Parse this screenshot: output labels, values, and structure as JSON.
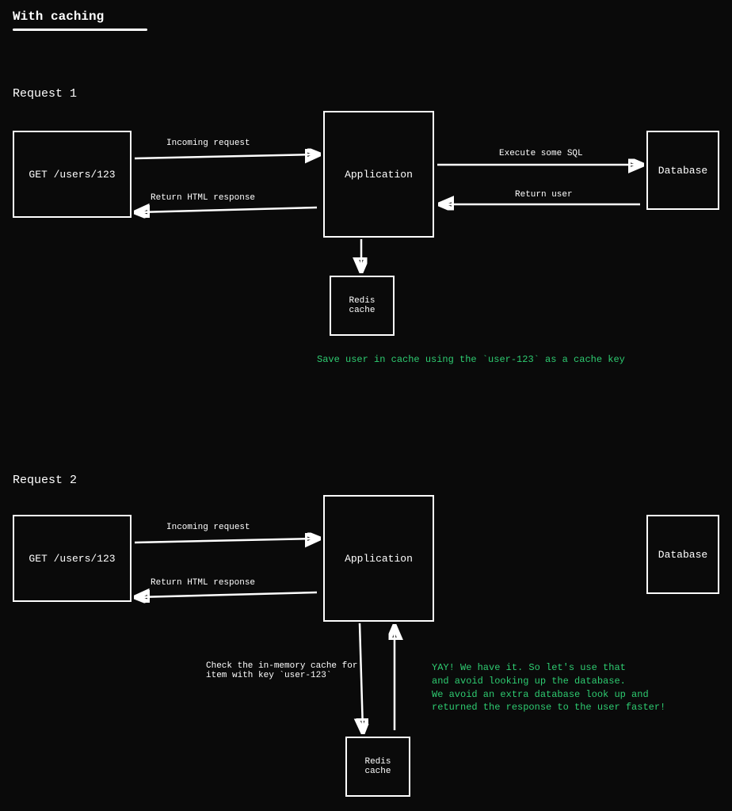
{
  "title": "With caching",
  "sections": {
    "req1": {
      "heading": "Request 1"
    },
    "req2": {
      "heading": "Request 2"
    }
  },
  "boxes": {
    "client1": "GET /users/123",
    "app1": "Application",
    "db1": "Database",
    "redis1": "Redis cache",
    "client2": "GET /users/123",
    "app2": "Application",
    "db2": "Database",
    "redis2": "Redis cache"
  },
  "labels": {
    "incoming1": "Incoming request",
    "returnHtml1": "Return HTML response",
    "execSql": "Execute some SQL",
    "returnUser": "Return user",
    "incoming2": "Incoming request",
    "returnHtml2": "Return HTML response",
    "checkCache": "Check the in-memory cache for\nitem with key `user-123`"
  },
  "notes": {
    "saveCache": "Save user in cache using the `user-123` as a cache key",
    "yay": "YAY! We have it. So let's use that\nand avoid looking up the database.\nWe avoid an extra database look up and\nreturned the response to the user faster!"
  },
  "colors": {
    "accent": "#2ecc71",
    "bg": "#0a0a0a",
    "fg": "#ffffff"
  }
}
